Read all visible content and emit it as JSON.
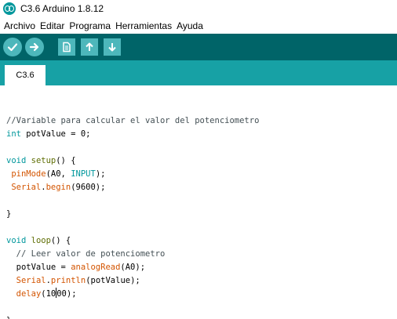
{
  "window": {
    "title": "C3.6 Arduino 1.8.12"
  },
  "menu": [
    "Archivo",
    "Editar",
    "Programa",
    "Herramientas",
    "Ayuda"
  ],
  "toolbar": {
    "buttons": [
      {
        "name": "verify",
        "icon": "check-icon"
      },
      {
        "name": "upload",
        "icon": "arrow-right-icon"
      },
      {
        "name": "new",
        "icon": "document-icon"
      },
      {
        "name": "open",
        "icon": "arrow-up-icon"
      },
      {
        "name": "save",
        "icon": "arrow-down-icon"
      }
    ]
  },
  "tabs": [
    {
      "label": "C3.6"
    }
  ],
  "editor": {
    "lines": [
      "",
      "//Variable para calcular el valor del potenciometro",
      "int potValue = 0;",
      "",
      "void setup() {",
      " pinMode(A0, INPUT);",
      " Serial.begin(9600);",
      "",
      "}",
      "",
      "void loop() {",
      "  // Leer valor de potenciometro",
      "  potValue = analogRead(A0);",
      "  Serial.println(potValue);",
      "  delay(1000);",
      "",
      "}"
    ]
  },
  "colors": {
    "toolbar": "#006468",
    "tabbar": "#17a1a5",
    "button": "#4db7bb",
    "keyword": "#00979c",
    "function": "#d35400",
    "comment": "#434f54"
  }
}
